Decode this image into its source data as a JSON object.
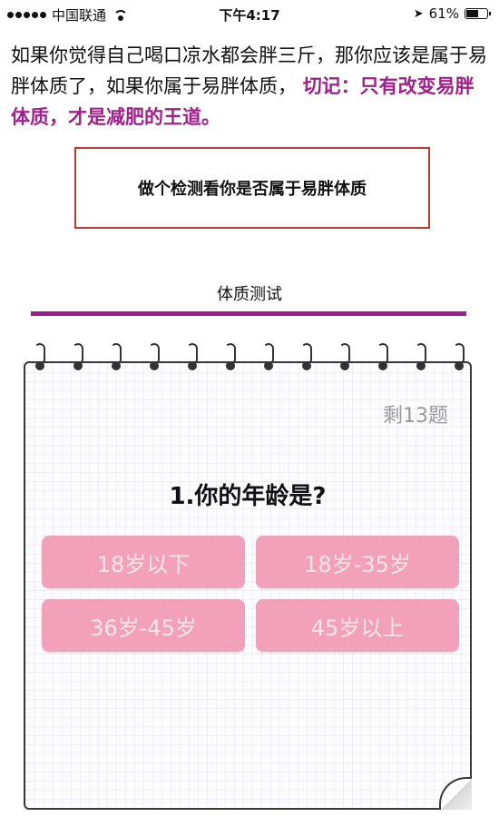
{
  "status_bar": {
    "carrier": "中国联通",
    "time": "下午4:17",
    "battery": "61%",
    "battery_level": 0.61
  },
  "intro": {
    "text": "如果你觉得自己喝口凉水都会胖三斤，那你应该是属于易胖体质了，如果你属于易胖体质，",
    "highlight": "切记：只有改变易胖体质，才是减肥的王道。",
    "highlight_color": "#a0208a"
  },
  "cta": {
    "label": "做个检测看你是否属于易胖体质",
    "border_color": "#c0392b"
  },
  "tab": {
    "title": "体质测试",
    "underline_color": "#9b1c8e"
  },
  "quiz": {
    "remaining": "剩13题",
    "question": "1.你的年龄是?",
    "options": [
      "18岁以下",
      "18岁-35岁",
      "36岁-45岁",
      "45岁以上"
    ],
    "option_color": "#f3a1bb"
  }
}
